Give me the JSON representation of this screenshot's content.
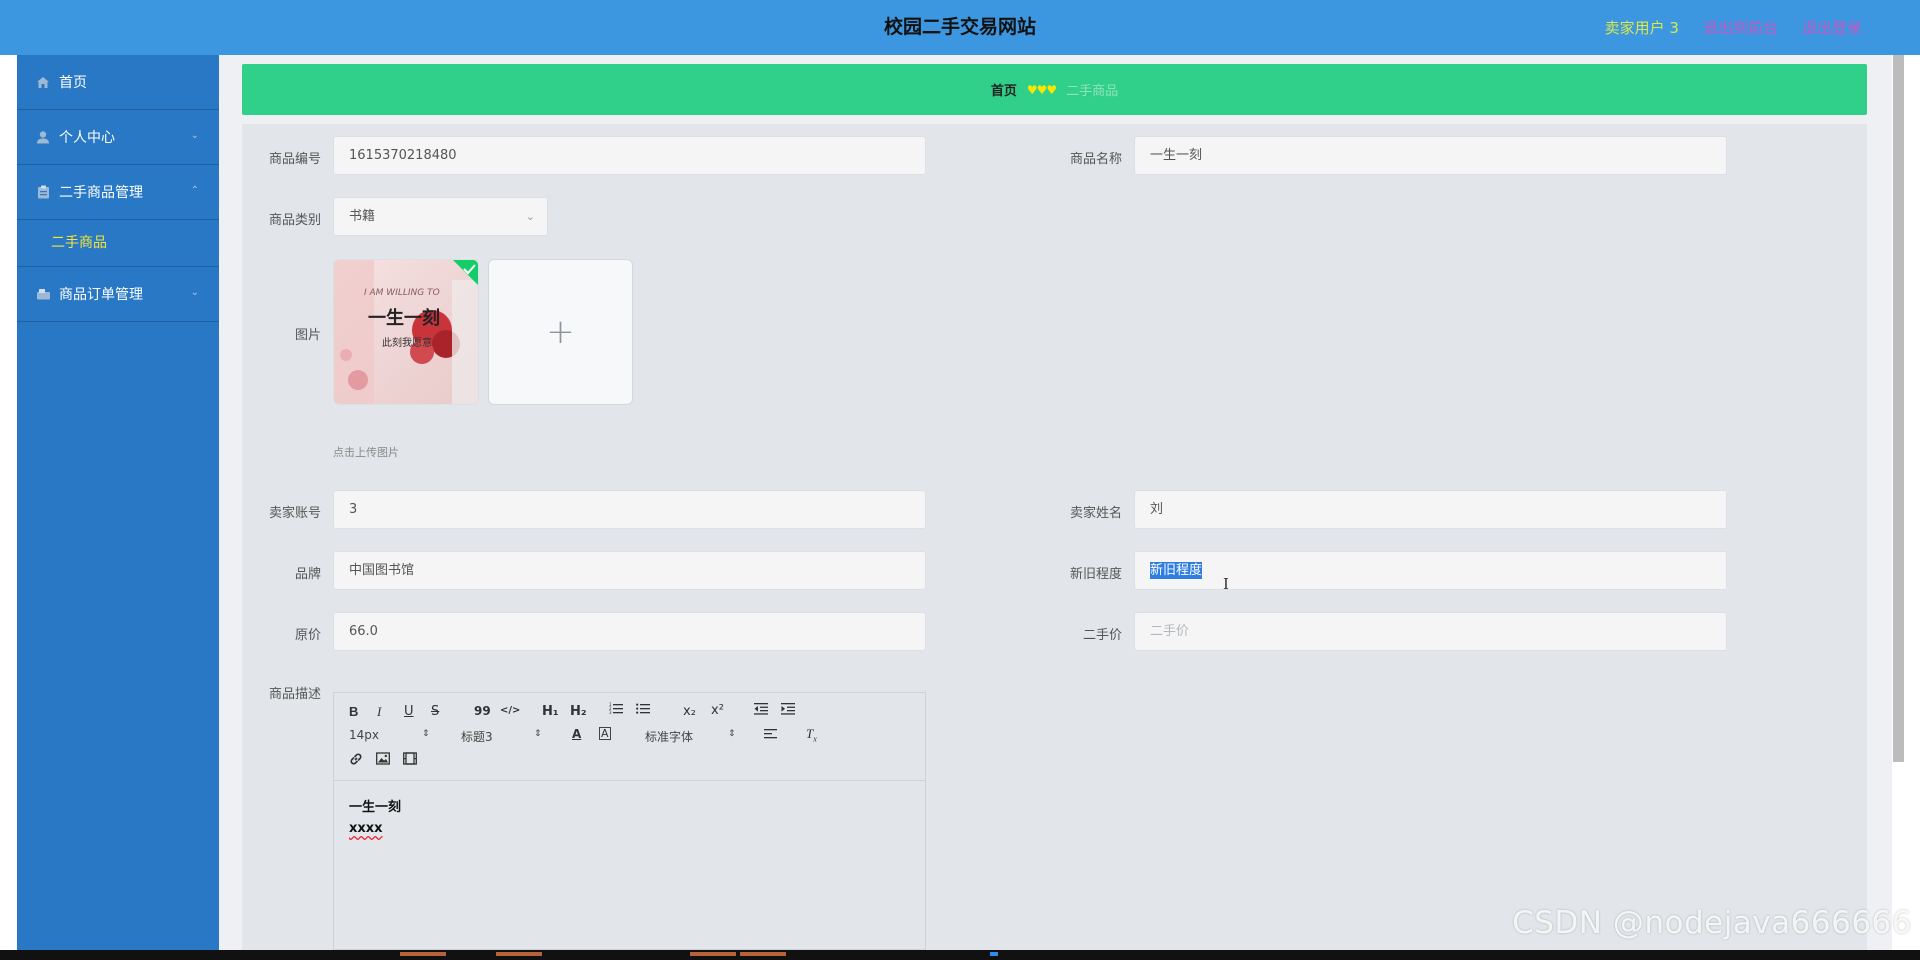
{
  "header": {
    "title": "校园二手交易网站",
    "user": "卖家用户 3",
    "back_front": "退出到前台",
    "logout": "退出登录",
    "colors": {
      "bar": "#3d97e0",
      "user": "#d9e84a",
      "links": "#c15ac7"
    }
  },
  "sidebar": {
    "items": [
      {
        "label": "首页",
        "icon": "home-icon"
      },
      {
        "label": "个人中心",
        "icon": "user-icon",
        "chevron": "chevron-down-icon"
      },
      {
        "label": "二手商品管理",
        "icon": "clipboard-icon",
        "chevron": "chevron-up-icon",
        "children": [
          {
            "label": "二手商品"
          }
        ]
      },
      {
        "label": "商品订单管理",
        "icon": "orders-icon",
        "chevron": "chevron-down-icon"
      }
    ],
    "colors": {
      "bg": "#2878c5",
      "active_sub": "#f5e43a"
    }
  },
  "breadcrumb": {
    "home": "首页",
    "separator": "♥♥♥",
    "current": "二手商品",
    "color": "#31d08a"
  },
  "form": {
    "code_label": "商品编号",
    "code_value": "1615370218480",
    "name_label": "商品名称",
    "name_value": "一生一刻",
    "category_label": "商品类别",
    "category_value": "书籍",
    "image_label": "图片",
    "upload_tip": "点击上传图片",
    "image_text": {
      "banner": "I AM WILLING TO",
      "main": "一生一刻",
      "sub": "此刻我愿意"
    },
    "seller_account_label": "卖家账号",
    "seller_account_value": "3",
    "seller_name_label": "卖家姓名",
    "seller_name_value": "刘",
    "brand_label": "品牌",
    "brand_value": "中国图书馆",
    "condition_label": "新旧程度",
    "condition_value": "新旧程度",
    "orig_price_label": "原价",
    "orig_price_value": "66.0",
    "second_price_label": "二手价",
    "second_price_placeholder": "二手价",
    "desc_label": "商品描述"
  },
  "editor": {
    "toolbar": {
      "bold": "B",
      "italic": "I",
      "underline": "U",
      "strike": "S",
      "quote": "99",
      "code": "</>",
      "h1": "H₁",
      "h2": "H₂",
      "subscript": "x₂",
      "superscript": "x²",
      "font_size": "14px",
      "heading": "标题3",
      "font_family": "标准字体"
    },
    "content": [
      "一生一刻",
      "xxxx"
    ]
  },
  "watermark": "CSDN @nodejava666666"
}
